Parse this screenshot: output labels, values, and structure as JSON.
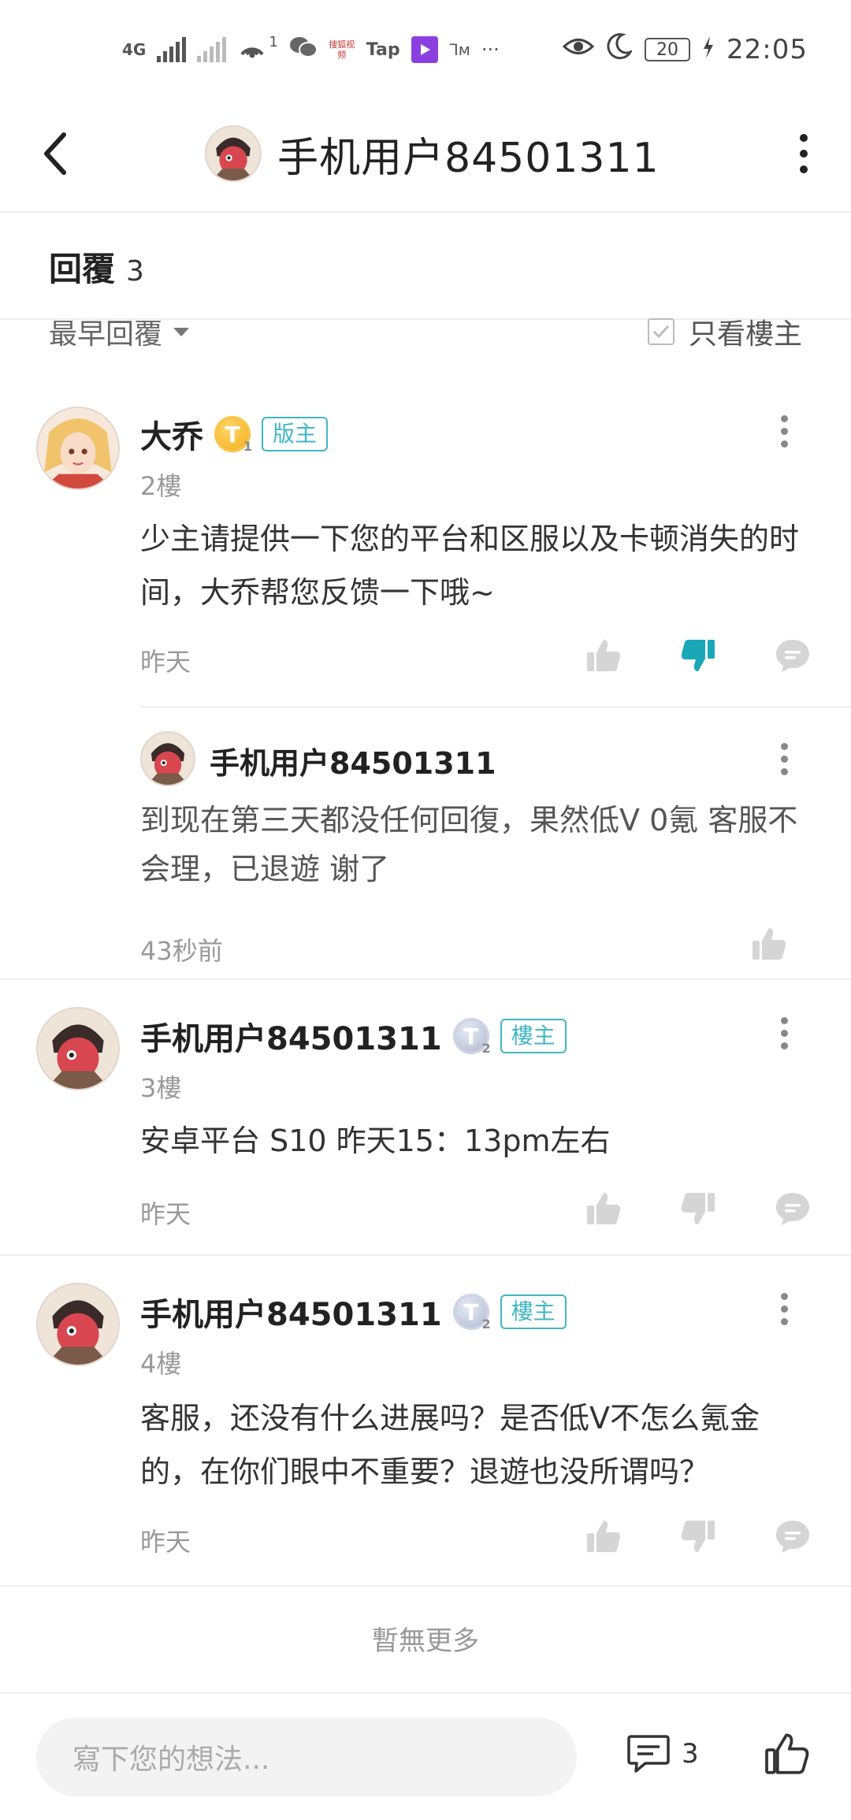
{
  "status_bar": {
    "network": "4G",
    "wifi_count": "1",
    "app_sohu": "搜狐视频",
    "app_tap": "Tap",
    "app_extra": "ᒣᴍ",
    "more": "···",
    "battery": "20",
    "time": "22:05"
  },
  "header": {
    "title": "手机用户84501311"
  },
  "replies": {
    "label": "回覆",
    "count": "3",
    "sort": "最早回覆",
    "only_op": "只看樓主"
  },
  "comments": [
    {
      "name": "大乔",
      "level": "T",
      "level_sub": "1",
      "badge": "版主",
      "floor": "2樓",
      "text": "少主请提供一下您的平台和区服以及卡顿消失的时间，大乔帮您反馈一下哦~",
      "time": "昨天"
    },
    {
      "name": "手机用户84501311",
      "level": "T",
      "level_sub": "2",
      "badge": "樓主",
      "floor": "3樓",
      "text": "安卓平台 S10 昨天15：13pm左右",
      "time": "昨天"
    },
    {
      "name": "手机用户84501311",
      "level": "T",
      "level_sub": "2",
      "badge": "樓主",
      "floor": "4樓",
      "text": "客服，还没有什么进展吗？是否低V不怎么氪金的，在你们眼中不重要？退遊也没所谓吗？",
      "time": "昨天"
    }
  ],
  "subreply": {
    "name": "手机用户84501311",
    "text": "到现在第三天都没任何回復，果然低V 0氪 客服不会理，已退遊 谢了",
    "time": "43秒前"
  },
  "no_more": "暫無更多",
  "bottom_bar": {
    "placeholder": "寫下您的想法...",
    "comment_count": "3"
  },
  "colors": {
    "accent": "#3fb6c4",
    "dislike_active": "#1aa7b8",
    "icon_gray": "#d5d5d5"
  }
}
